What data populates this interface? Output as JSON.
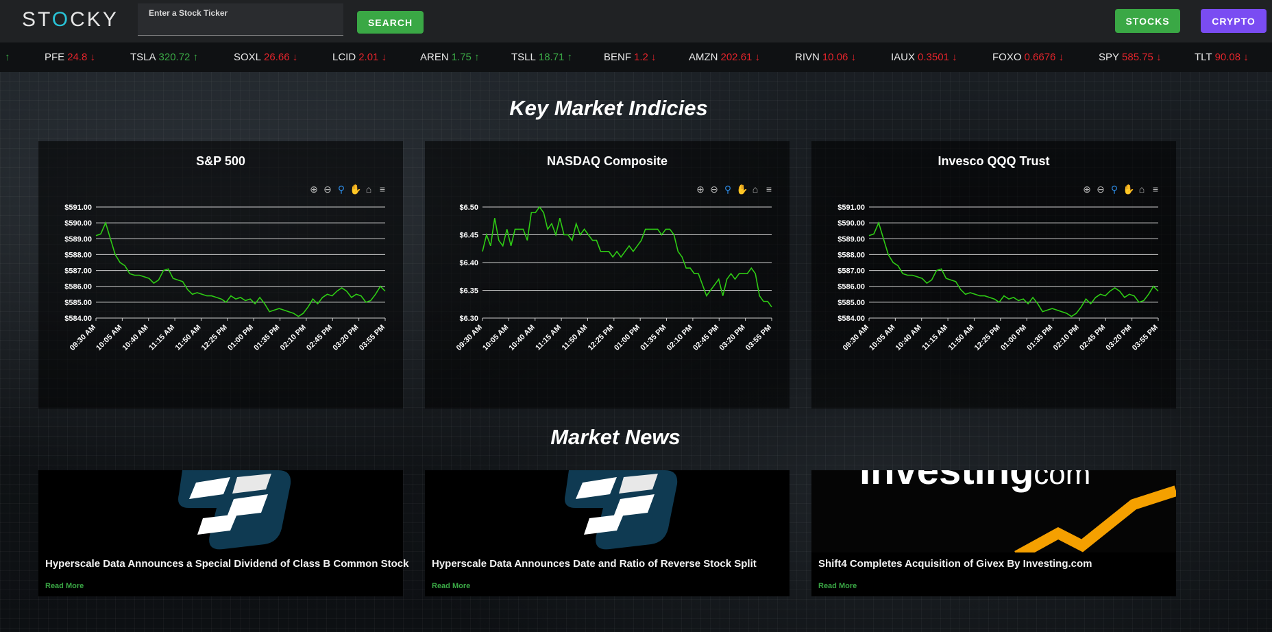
{
  "header": {
    "logo_prefix": "ST",
    "logo_o": "O",
    "logo_suffix": "CKY",
    "search_placeholder": "Enter a Stock Ticker",
    "search_button": "SEARCH",
    "stocks_button": "STOCKS",
    "crypto_button": "CRYPTO"
  },
  "ticker_lead_arrow": "↑",
  "ticker": [
    {
      "symbol": "PFE",
      "price": "24.8",
      "arrow": "↓",
      "direction": "down"
    },
    {
      "symbol": "TSLA",
      "price": "320.72",
      "arrow": "↑",
      "direction": "up"
    },
    {
      "symbol": "SOXL",
      "price": "26.66",
      "arrow": "↓",
      "direction": "down"
    },
    {
      "symbol": "LCID",
      "price": "2.01",
      "arrow": "↓",
      "direction": "down"
    },
    {
      "symbol": "AREN",
      "price": "1.75",
      "arrow": "↑",
      "direction": "up"
    },
    {
      "symbol": "TSLL",
      "price": "18.71",
      "arrow": "↑",
      "direction": "up"
    },
    {
      "symbol": "BENF",
      "price": "1.2",
      "arrow": "↓",
      "direction": "down"
    },
    {
      "symbol": "AMZN",
      "price": "202.61",
      "arrow": "↓",
      "direction": "down"
    },
    {
      "symbol": "RIVN",
      "price": "10.06",
      "arrow": "↓",
      "direction": "down"
    },
    {
      "symbol": "IAUX",
      "price": "0.3501",
      "arrow": "↓",
      "direction": "down"
    },
    {
      "symbol": "FOXO",
      "price": "0.6676",
      "arrow": "↓",
      "direction": "down"
    },
    {
      "symbol": "SPY",
      "price": "585.75",
      "arrow": "↓",
      "direction": "down"
    },
    {
      "symbol": "TLT",
      "price": "90.08",
      "arrow": "↓",
      "direction": "down"
    }
  ],
  "key_market_title": "Key Market Indicies",
  "market_news_title": "Market News",
  "colors": {
    "accent_green": "#3aa845",
    "accent_red": "#e3242b",
    "accent_purple": "#7a4cf2",
    "line_green": "#2ecc14"
  },
  "toolbar_icons": [
    "zoom-in-icon",
    "zoom-out-icon",
    "magnifier-icon",
    "pan-hand-icon",
    "home-icon",
    "menu-icon"
  ],
  "chart_data": [
    {
      "type": "line",
      "title": "S&P 500",
      "x": [
        "09:30 AM",
        "10:05 AM",
        "10:40 AM",
        "11:15 AM",
        "11:50 AM",
        "12:25 PM",
        "01:00 PM",
        "01:35 PM",
        "02:10 PM",
        "02:45 PM",
        "03:20 PM",
        "03:55 PM"
      ],
      "yticks": [
        "$584.00",
        "$585.00",
        "$586.00",
        "$587.00",
        "$588.00",
        "$589.00",
        "$590.00",
        "$591.00"
      ],
      "ylim": [
        584,
        591
      ],
      "series": [
        {
          "values": [
            589.2,
            589.3,
            590.0,
            589.0,
            588.0,
            587.5,
            587.3,
            586.8,
            586.7,
            586.7,
            586.6,
            586.5,
            586.2,
            586.4,
            587.0,
            587.1,
            586.5,
            586.4,
            586.3,
            585.8,
            585.5,
            585.6,
            585.5,
            585.4,
            585.4,
            585.3,
            585.2,
            585.0,
            585.4,
            585.2,
            585.3,
            585.1,
            585.2,
            584.9,
            585.3,
            584.9,
            584.4,
            584.5,
            584.6,
            584.5,
            584.4,
            584.3,
            584.1,
            584.3,
            584.7,
            585.2,
            584.9,
            585.3,
            585.5,
            585.4,
            585.7,
            585.9,
            585.7,
            585.3,
            585.5,
            585.4,
            585.0,
            585.1,
            585.5,
            586.0,
            585.7
          ]
        }
      ]
    },
    {
      "type": "line",
      "title": "NASDAQ Composite",
      "x": [
        "09:30 AM",
        "10:05 AM",
        "10:40 AM",
        "11:15 AM",
        "11:50 AM",
        "12:25 PM",
        "01:00 PM",
        "01:35 PM",
        "02:10 PM",
        "02:45 PM",
        "03:20 PM",
        "03:55 PM"
      ],
      "yticks": [
        "$6.30",
        "$6.35",
        "$6.40",
        "$6.45",
        "$6.50"
      ],
      "ylim": [
        6.3,
        6.5
      ],
      "series": [
        {
          "values": [
            6.42,
            6.45,
            6.43,
            6.48,
            6.44,
            6.43,
            6.46,
            6.43,
            6.46,
            6.46,
            6.46,
            6.44,
            6.49,
            6.49,
            6.5,
            6.49,
            6.46,
            6.47,
            6.45,
            6.48,
            6.45,
            6.45,
            6.44,
            6.47,
            6.45,
            6.46,
            6.45,
            6.44,
            6.44,
            6.42,
            6.42,
            6.42,
            6.41,
            6.42,
            6.41,
            6.42,
            6.43,
            6.42,
            6.43,
            6.44,
            6.46,
            6.46,
            6.46,
            6.46,
            6.45,
            6.46,
            6.46,
            6.45,
            6.42,
            6.41,
            6.39,
            6.39,
            6.38,
            6.38,
            6.36,
            6.34,
            6.35,
            6.36,
            6.37,
            6.34,
            6.37,
            6.38,
            6.37,
            6.38,
            6.38,
            6.38,
            6.39,
            6.38,
            6.34,
            6.33,
            6.33,
            6.32
          ]
        }
      ]
    },
    {
      "type": "line",
      "title": "Invesco QQQ Trust",
      "x": [
        "09:30 AM",
        "10:05 AM",
        "10:40 AM",
        "11:15 AM",
        "11:50 AM",
        "12:25 PM",
        "01:00 PM",
        "01:35 PM",
        "02:10 PM",
        "02:45 PM",
        "03:20 PM",
        "03:55 PM"
      ],
      "yticks": [
        "$584.00",
        "$585.00",
        "$586.00",
        "$587.00",
        "$588.00",
        "$589.00",
        "$590.00",
        "$591.00"
      ],
      "ylim": [
        584,
        591
      ],
      "series": [
        {
          "values": [
            589.2,
            589.3,
            590.0,
            589.0,
            588.0,
            587.5,
            587.3,
            586.8,
            586.7,
            586.7,
            586.6,
            586.5,
            586.2,
            586.4,
            587.0,
            587.1,
            586.5,
            586.4,
            586.3,
            585.8,
            585.5,
            585.6,
            585.5,
            585.4,
            585.4,
            585.3,
            585.2,
            585.0,
            585.4,
            585.2,
            585.3,
            585.1,
            585.2,
            584.9,
            585.3,
            584.9,
            584.4,
            584.5,
            584.6,
            584.5,
            584.4,
            584.3,
            584.1,
            584.3,
            584.7,
            585.2,
            584.9,
            585.3,
            585.5,
            585.4,
            585.7,
            585.9,
            585.7,
            585.3,
            585.5,
            585.4,
            585.0,
            585.1,
            585.5,
            586.0,
            585.7
          ]
        }
      ]
    }
  ],
  "news": [
    {
      "title": "Hyperscale Data Announces a Special Dividend of Class B Common Stock",
      "link": "Read More",
      "image": "hyperscale-logo"
    },
    {
      "title": "Hyperscale Data Announces Date and Ratio of Reverse Stock Split",
      "link": "Read More",
      "image": "hyperscale-logo"
    },
    {
      "title": "Shift4 Completes Acquisition of Givex By Investing.com",
      "link": "Read More",
      "image": "investing-logo",
      "image_text": "Investing",
      "image_text_suffix": ".com"
    }
  ]
}
